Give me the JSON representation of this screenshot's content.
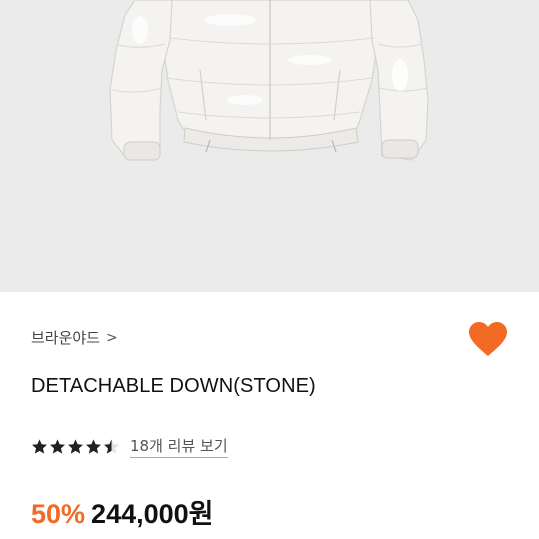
{
  "product": {
    "image_alt": "",
    "brand_label": "브라운야드",
    "brand_chevron": ">",
    "title": "DETACHABLE DOWN(STONE)",
    "rating_stars": 4.5,
    "review_link": "18개 리뷰 보기",
    "discount": "50%",
    "price": "244,000원",
    "favorite_active": true
  },
  "colors": {
    "accent": "#f26a24",
    "hero_bg": "#ebebeb",
    "star": "#222222"
  },
  "icons": {
    "favorite": "heart-icon",
    "brand_arrow": "chevron-right-icon",
    "rating": "star-icon"
  }
}
